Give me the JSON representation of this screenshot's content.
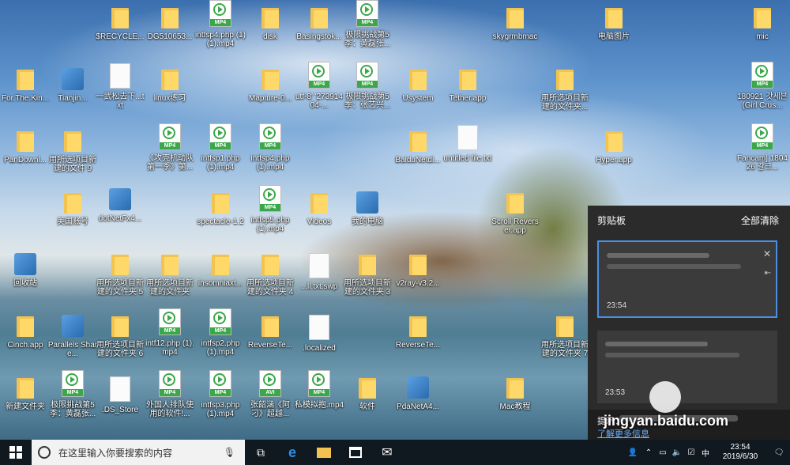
{
  "desktop": {
    "icons": [
      {
        "type": "folder",
        "label": "$RECYCLE..."
      },
      {
        "type": "folder",
        "label": "DG510653..."
      },
      {
        "type": "mp4",
        "label": "intfsp4.php (1)(1).mp4"
      },
      {
        "type": "folder",
        "label": "disk"
      },
      {
        "type": "folder",
        "label": "Basingstok..."
      },
      {
        "type": "mp4",
        "label": "极限挑战第5季：黄磊张..."
      },
      {
        "type": "folder",
        "label": "skygrmbmac"
      },
      {
        "type": "folder",
        "label": "电脑图片"
      },
      {
        "type": "folder",
        "label": "mic"
      },
      {
        "type": "folder",
        "label": "For.The.Kin..."
      },
      {
        "type": "app",
        "label": "Tianjin..."
      },
      {
        "type": "doc",
        "label": "一武松去下...txt"
      },
      {
        "type": "folder",
        "label": "linux练习"
      },
      {
        "type": "folder",
        "label": "Mapture-0..."
      },
      {
        "type": "mp4",
        "label": "utf-8' '27391404-..."
      },
      {
        "type": "mp4",
        "label": "极限挑战第5季：张艺兴..."
      },
      {
        "type": "folder",
        "label": "Usystem"
      },
      {
        "type": "folder",
        "label": "Tether.app"
      },
      {
        "type": "folder",
        "label": "用所选项目新建的文件夹..."
      },
      {
        "type": "mp4",
        "label": "180921 갓세븐(Girl Crus..."
      },
      {
        "type": "folder",
        "label": "PanDownl..."
      },
      {
        "type": "folder",
        "label": "用所选项目新建的文件 9"
      },
      {
        "type": "mp4",
        "label": "《攻壳机动队第一季》第..."
      },
      {
        "type": "mp4",
        "label": "intfsp1.php (1).mp4"
      },
      {
        "type": "mp4",
        "label": "intfsp4.php (1).mp4"
      },
      {
        "type": "folder",
        "label": "BaiduNetdi..."
      },
      {
        "type": "doc",
        "label": "untitled file.txt"
      },
      {
        "type": "folder",
        "label": "Hyper.app"
      },
      {
        "type": "mp4",
        "label": "Fancam] 180426 갈크..."
      },
      {
        "type": "folder",
        "label": "美国账号"
      },
      {
        "type": "app",
        "label": "dotNetFx4..."
      },
      {
        "type": "folder",
        "label": "spectacle-1.2"
      },
      {
        "type": "mp4",
        "label": "intfsp5.php (1).mp4"
      },
      {
        "type": "folder",
        "label": "Videos"
      },
      {
        "type": "app",
        "label": "我的电脑"
      },
      {
        "type": "folder",
        "label": "Scroll Reverser.app"
      },
      {
        "type": "app",
        "label": "回收站"
      },
      {
        "type": "folder",
        "label": "用所选项目新建的文件夹 5"
      },
      {
        "type": "folder",
        "label": "用所选项目新建的文件夹"
      },
      {
        "type": "folder",
        "label": "insomniaxt..."
      },
      {
        "type": "folder",
        "label": "用所选项目新建的文件夹 4"
      },
      {
        "type": "doc",
        "label": "...ll.txt.swp"
      },
      {
        "type": "folder",
        "label": "用所选项目新建的文件夹 3"
      },
      {
        "type": "folder",
        "label": "v2ray-v3.2..."
      },
      {
        "type": "folder",
        "label": "Cinch.app"
      },
      {
        "type": "app",
        "label": "Parallels Share..."
      },
      {
        "type": "folder",
        "label": "用所选项目新建的文件夹 6"
      },
      {
        "type": "mp4",
        "label": "intf12.php (1).mp4"
      },
      {
        "type": "mp4",
        "label": "intfsp2.php (1).mp4"
      },
      {
        "type": "folder",
        "label": "ReverseTe..."
      },
      {
        "type": "doc",
        "label": ".localized"
      },
      {
        "type": "folder",
        "label": "ReverseTe..."
      },
      {
        "type": "folder",
        "label": "用所选项目新建的文件夹 7"
      },
      {
        "type": "folder",
        "label": "新建文件夹"
      },
      {
        "type": "mp4",
        "label": "极限挑战第5季：黄磊张..."
      },
      {
        "type": "doc",
        "label": ".DS_Store"
      },
      {
        "type": "mp4",
        "label": "外国人排队使用的软件!..."
      },
      {
        "type": "mp4",
        "label": "intfsp3.php (1).mp4"
      },
      {
        "type": "avi",
        "label": "张韶涵《阿刁》超越..."
      },
      {
        "type": "mp4",
        "label": "私模拟抱.mp4"
      },
      {
        "type": "folder",
        "label": "软件"
      },
      {
        "type": "app",
        "label": "PdaNetA4..."
      },
      {
        "type": "folder",
        "label": "Mac教程"
      }
    ]
  },
  "clipboard": {
    "title": "剪贴板",
    "clear_all": "全部清除",
    "items": [
      {
        "time": "23:54"
      },
      {
        "time": "23:53"
      }
    ],
    "tip_label": "提示：",
    "tip_link": "了解更多信息"
  },
  "taskbar": {
    "search_placeholder": "在这里输入你要搜索的内容",
    "time": "23:54",
    "date": "2019/6/30"
  },
  "watermark": "jingyan.baidu.com",
  "colors": {
    "folder": "#f3c34f",
    "mp4_tag": "#3aa74a",
    "taskbar": "#101820",
    "clipboard_bg": "#2b2b2b"
  }
}
